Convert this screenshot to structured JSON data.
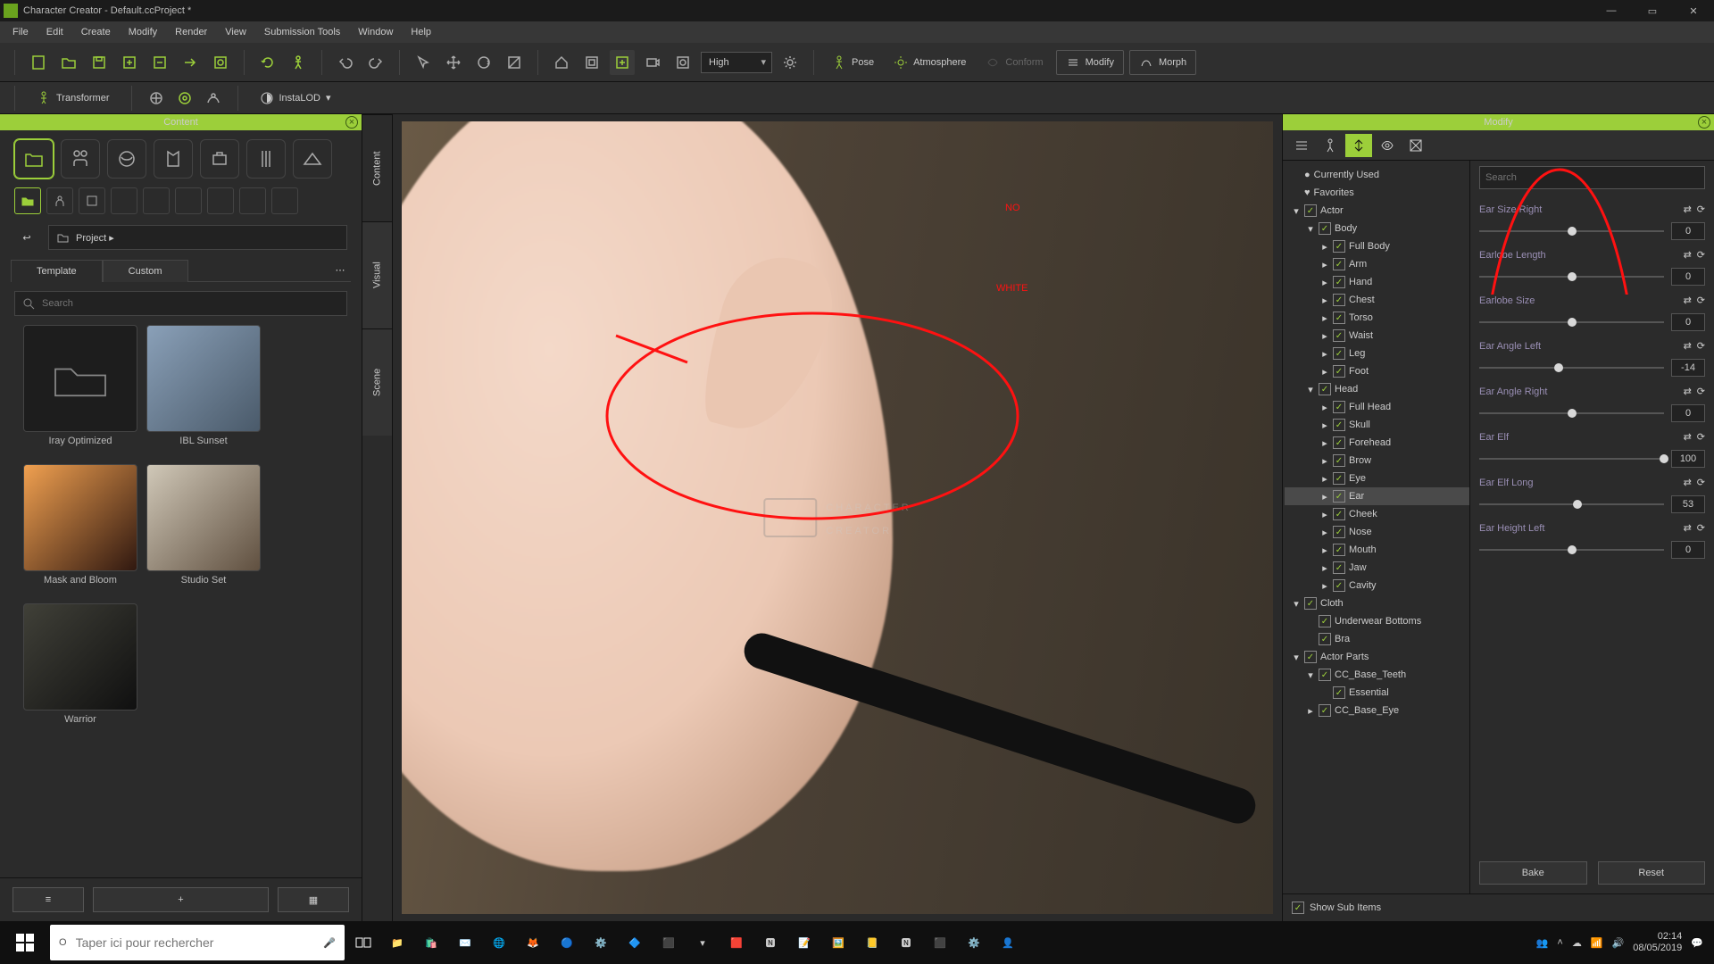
{
  "title": "Character Creator - Default.ccProject *",
  "win_buttons": {
    "min": "—",
    "max": "▭",
    "close": "✕"
  },
  "menus": [
    "File",
    "Edit",
    "Create",
    "Modify",
    "Render",
    "View",
    "Submission Tools",
    "Window",
    "Help"
  ],
  "quality_select": "High",
  "top_labeled": {
    "pose": "Pose",
    "atmosphere": "Atmosphere",
    "conform": "Conform",
    "modify": "Modify",
    "morph": "Morph"
  },
  "toolbar2": {
    "transformer": "Transformer",
    "instalod": "InstaLOD"
  },
  "content_panel": {
    "title": "Content",
    "breadcrumb": "Project ▸",
    "tabs": {
      "template": "Template",
      "custom": "Custom"
    },
    "search_placeholder": "Search",
    "thumbs": [
      {
        "label": "Iray Optimized",
        "kind": "folder"
      },
      {
        "label": "IBL Sunset",
        "kind": "img"
      },
      {
        "label": "Mask and Bloom",
        "kind": "img"
      },
      {
        "label": "Studio Set",
        "kind": "img"
      },
      {
        "label": "Warrior",
        "kind": "img"
      }
    ],
    "bottom": {
      "add": "+"
    }
  },
  "side_tabs": [
    "Content",
    "Visual",
    "Scene"
  ],
  "watermark": {
    "line1": "CHARACTER",
    "line2": "CREATOR"
  },
  "annotations": {
    "text1": "NO",
    "text2": "WHITE"
  },
  "modify_panel": {
    "title": "Modify",
    "search_placeholder": "Search",
    "tree": [
      {
        "d": 0,
        "icon": "bullet",
        "label": "Currently Used"
      },
      {
        "d": 0,
        "icon": "heart",
        "label": "Favorites"
      },
      {
        "d": 0,
        "tri": "▾",
        "chk": true,
        "label": "Actor"
      },
      {
        "d": 1,
        "tri": "▾",
        "chk": true,
        "label": "Body"
      },
      {
        "d": 2,
        "tri": "▸",
        "chk": true,
        "label": "Full Body"
      },
      {
        "d": 2,
        "tri": "▸",
        "chk": true,
        "label": "Arm"
      },
      {
        "d": 2,
        "tri": "▸",
        "chk": true,
        "label": "Hand"
      },
      {
        "d": 2,
        "tri": "▸",
        "chk": true,
        "label": "Chest"
      },
      {
        "d": 2,
        "tri": "▸",
        "chk": true,
        "label": "Torso"
      },
      {
        "d": 2,
        "tri": "▸",
        "chk": true,
        "label": "Waist"
      },
      {
        "d": 2,
        "tri": "▸",
        "chk": true,
        "label": "Leg"
      },
      {
        "d": 2,
        "tri": "▸",
        "chk": true,
        "label": "Foot"
      },
      {
        "d": 1,
        "tri": "▾",
        "chk": true,
        "label": "Head"
      },
      {
        "d": 2,
        "tri": "▸",
        "chk": true,
        "label": "Full Head"
      },
      {
        "d": 2,
        "tri": "▸",
        "chk": true,
        "label": "Skull"
      },
      {
        "d": 2,
        "tri": "▸",
        "chk": true,
        "label": "Forehead"
      },
      {
        "d": 2,
        "tri": "▸",
        "chk": true,
        "label": "Brow"
      },
      {
        "d": 2,
        "tri": "▸",
        "chk": true,
        "label": "Eye"
      },
      {
        "d": 2,
        "tri": "▸",
        "chk": true,
        "label": "Ear",
        "sel": true
      },
      {
        "d": 2,
        "tri": "▸",
        "chk": true,
        "label": "Cheek"
      },
      {
        "d": 2,
        "tri": "▸",
        "chk": true,
        "label": "Nose"
      },
      {
        "d": 2,
        "tri": "▸",
        "chk": true,
        "label": "Mouth"
      },
      {
        "d": 2,
        "tri": "▸",
        "chk": true,
        "label": "Jaw"
      },
      {
        "d": 2,
        "tri": "▸",
        "chk": true,
        "label": "Cavity"
      },
      {
        "d": 0,
        "tri": "▾",
        "chk": true,
        "label": "Cloth"
      },
      {
        "d": 1,
        "chk": true,
        "label": "Underwear Bottoms"
      },
      {
        "d": 1,
        "chk": true,
        "label": "Bra"
      },
      {
        "d": 0,
        "tri": "▾",
        "chk": true,
        "label": "Actor Parts"
      },
      {
        "d": 1,
        "tri": "▾",
        "chk": true,
        "label": "CC_Base_Teeth"
      },
      {
        "d": 2,
        "chk": true,
        "label": "Essential"
      },
      {
        "d": 1,
        "tri": "▸",
        "chk": true,
        "label": "CC_Base_Eye"
      }
    ],
    "show_sub": "Show Sub Items",
    "morphs": [
      {
        "name": "Ear Size Right",
        "value": 0,
        "min": -100,
        "max": 100
      },
      {
        "name": "Earlobe Length",
        "value": 0,
        "min": -100,
        "max": 100
      },
      {
        "name": "Earlobe Size",
        "value": 0,
        "min": -100,
        "max": 100
      },
      {
        "name": "Ear Angle Left",
        "value": -14,
        "min": -100,
        "max": 100
      },
      {
        "name": "Ear Angle Right",
        "value": 0,
        "min": -100,
        "max": 100
      },
      {
        "name": "Ear Elf",
        "value": 100,
        "min": 0,
        "max": 100
      },
      {
        "name": "Ear Elf Long",
        "value": 53,
        "min": 0,
        "max": 100
      },
      {
        "name": "Ear Height Left",
        "value": 0,
        "min": -100,
        "max": 100
      }
    ],
    "buttons": {
      "bake": "Bake",
      "reset": "Reset"
    }
  },
  "taskbar": {
    "search_placeholder": "Taper ici pour rechercher",
    "time": "02:14",
    "date": "08/05/2019"
  }
}
